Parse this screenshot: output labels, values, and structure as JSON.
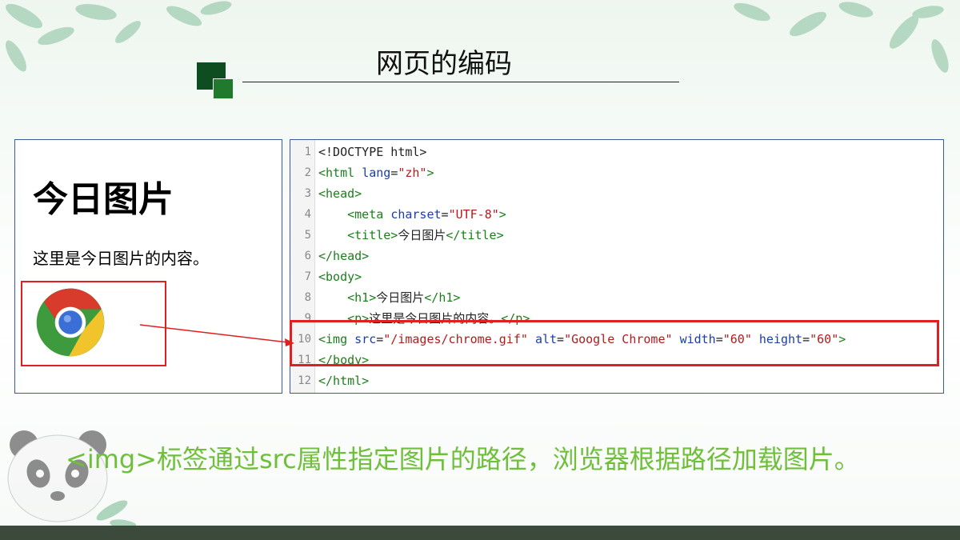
{
  "slide": {
    "title": "网页的编码",
    "caption": "<img>标签通过src属性指定图片的路径，浏览器根据路径加载图片。"
  },
  "preview": {
    "heading": "今日图片",
    "paragraph": "这里是今日图片的内容。"
  },
  "code_lines": [
    {
      "num": "1",
      "segments": [
        {
          "k": "plain",
          "t": "<!DOCTYPE html>"
        }
      ]
    },
    {
      "num": "2",
      "segments": [
        {
          "k": "t",
          "t": "<html"
        },
        {
          "k": "plain",
          "t": " "
        },
        {
          "k": "a",
          "t": "lang"
        },
        {
          "k": "plain",
          "t": "="
        },
        {
          "k": "v",
          "t": "\"zh\""
        },
        {
          "k": "t",
          "t": ">"
        }
      ]
    },
    {
      "num": "3",
      "segments": [
        {
          "k": "t",
          "t": "<head>"
        }
      ]
    },
    {
      "num": "4",
      "segments": [
        {
          "k": "plain",
          "t": "    "
        },
        {
          "k": "t",
          "t": "<meta"
        },
        {
          "k": "plain",
          "t": " "
        },
        {
          "k": "a",
          "t": "charset"
        },
        {
          "k": "plain",
          "t": "="
        },
        {
          "k": "v",
          "t": "\"UTF-8\""
        },
        {
          "k": "t",
          "t": ">"
        }
      ]
    },
    {
      "num": "5",
      "segments": [
        {
          "k": "plain",
          "t": "    "
        },
        {
          "k": "t",
          "t": "<title>"
        },
        {
          "k": "plain",
          "t": "今日图片"
        },
        {
          "k": "t",
          "t": "</title>"
        }
      ]
    },
    {
      "num": "6",
      "segments": [
        {
          "k": "t",
          "t": "</head>"
        }
      ]
    },
    {
      "num": "7",
      "segments": [
        {
          "k": "t",
          "t": "<body>"
        }
      ]
    },
    {
      "num": "8",
      "segments": [
        {
          "k": "plain",
          "t": "    "
        },
        {
          "k": "t",
          "t": "<h1>"
        },
        {
          "k": "plain",
          "t": "今日图片"
        },
        {
          "k": "t",
          "t": "</h1>"
        }
      ]
    },
    {
      "num": "9",
      "segments": [
        {
          "k": "plain",
          "t": "    "
        },
        {
          "k": "t",
          "t": "<p>"
        },
        {
          "k": "plain",
          "t": "这里是今日图片的内容。"
        },
        {
          "k": "t",
          "t": "</p>"
        }
      ]
    },
    {
      "num": "10",
      "segments": [
        {
          "k": "t",
          "t": "<img"
        },
        {
          "k": "plain",
          "t": " "
        },
        {
          "k": "a",
          "t": "src"
        },
        {
          "k": "plain",
          "t": "="
        },
        {
          "k": "v",
          "t": "\"/images/chrome.gif\""
        },
        {
          "k": "plain",
          "t": " "
        },
        {
          "k": "a",
          "t": "alt"
        },
        {
          "k": "plain",
          "t": "="
        },
        {
          "k": "v",
          "t": "\"Google Chrome\""
        },
        {
          "k": "plain",
          "t": " "
        },
        {
          "k": "a",
          "t": "width"
        },
        {
          "k": "plain",
          "t": "="
        },
        {
          "k": "v",
          "t": "\"60\""
        },
        {
          "k": "plain",
          "t": " "
        },
        {
          "k": "a",
          "t": "height"
        },
        {
          "k": "plain",
          "t": "="
        },
        {
          "k": "v",
          "t": "\"60\""
        },
        {
          "k": "t",
          "t": ">"
        }
      ]
    },
    {
      "num": "11",
      "segments": [
        {
          "k": "t",
          "t": "</body>"
        }
      ]
    },
    {
      "num": "12",
      "segments": [
        {
          "k": "t",
          "t": "</html>"
        }
      ]
    }
  ],
  "colors": {
    "highlight": "#e02020",
    "caption": "#6fbf3b",
    "tag": "#1a7f1a",
    "attr": "#1a3db0",
    "value": "#b01c1c"
  },
  "icons": [
    "leaves-decoration",
    "chrome-logo-icon",
    "panda-illustration",
    "arrow-icon"
  ]
}
